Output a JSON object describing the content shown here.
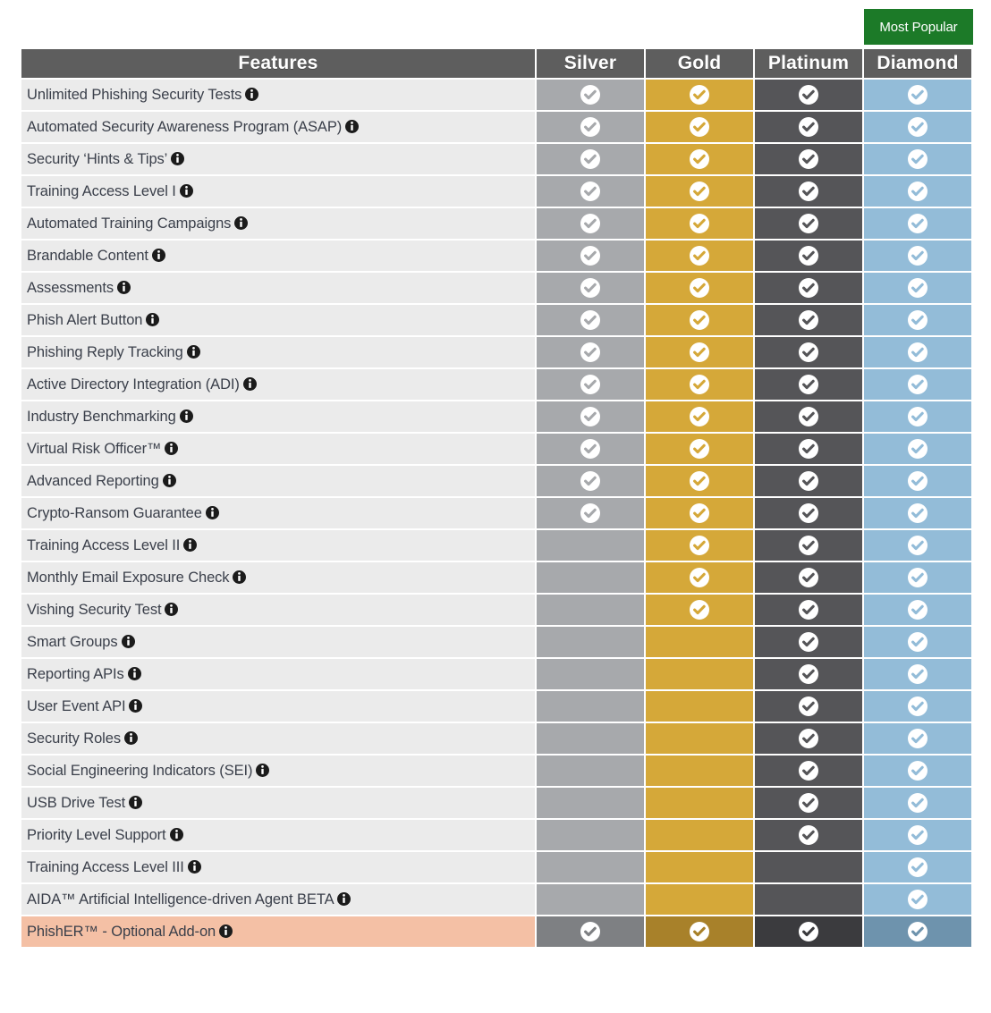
{
  "badge": {
    "label": "Most Popular",
    "color": "#1c7a28",
    "column": "Diamond"
  },
  "table": {
    "columns": [
      {
        "key": "feature",
        "label": "Features",
        "header_bg": "#5e5e5e"
      },
      {
        "key": "silver",
        "label": "Silver",
        "cell_bg": "#a7a9ac",
        "cell_bg_alt": "#7e8083"
      },
      {
        "key": "gold",
        "label": "Gold",
        "cell_bg": "#d5a839",
        "cell_bg_alt": "#a8812a"
      },
      {
        "key": "platinum",
        "label": "Platinum",
        "cell_bg": "#555558",
        "cell_bg_alt": "#3b3b3e"
      },
      {
        "key": "diamond",
        "label": "Diamond",
        "cell_bg": "#93bcd8",
        "cell_bg_alt": "#6e93ad"
      }
    ],
    "row_bg": "#ebebeb",
    "highlight_row_bg": "#f4c0a5",
    "info_icon": "info-icon",
    "check_icon": "check-circle-icon",
    "rows": [
      {
        "feature": "Unlimited Phishing Security Tests",
        "silver": true,
        "gold": true,
        "platinum": true,
        "diamond": true,
        "highlight": false
      },
      {
        "feature": "Automated Security Awareness Program (ASAP)",
        "silver": true,
        "gold": true,
        "platinum": true,
        "diamond": true,
        "highlight": false
      },
      {
        "feature": "Security ‘Hints & Tips’",
        "silver": true,
        "gold": true,
        "platinum": true,
        "diamond": true,
        "highlight": false
      },
      {
        "feature": "Training Access Level I",
        "silver": true,
        "gold": true,
        "platinum": true,
        "diamond": true,
        "highlight": false
      },
      {
        "feature": "Automated Training Campaigns",
        "silver": true,
        "gold": true,
        "platinum": true,
        "diamond": true,
        "highlight": false
      },
      {
        "feature": "Brandable Content",
        "silver": true,
        "gold": true,
        "platinum": true,
        "diamond": true,
        "highlight": false
      },
      {
        "feature": "Assessments",
        "silver": true,
        "gold": true,
        "platinum": true,
        "diamond": true,
        "highlight": false
      },
      {
        "feature": "Phish Alert Button",
        "silver": true,
        "gold": true,
        "platinum": true,
        "diamond": true,
        "highlight": false
      },
      {
        "feature": "Phishing Reply Tracking",
        "silver": true,
        "gold": true,
        "platinum": true,
        "diamond": true,
        "highlight": false
      },
      {
        "feature": "Active Directory Integration (ADI)",
        "silver": true,
        "gold": true,
        "platinum": true,
        "diamond": true,
        "highlight": false
      },
      {
        "feature": "Industry Benchmarking",
        "silver": true,
        "gold": true,
        "platinum": true,
        "diamond": true,
        "highlight": false
      },
      {
        "feature": "Virtual Risk Officer™",
        "silver": true,
        "gold": true,
        "platinum": true,
        "diamond": true,
        "highlight": false
      },
      {
        "feature": "Advanced Reporting",
        "silver": true,
        "gold": true,
        "platinum": true,
        "diamond": true,
        "highlight": false
      },
      {
        "feature": "Crypto-Ransom Guarantee",
        "silver": true,
        "gold": true,
        "platinum": true,
        "diamond": true,
        "highlight": false
      },
      {
        "feature": "Training Access Level II",
        "silver": false,
        "gold": true,
        "platinum": true,
        "diamond": true,
        "highlight": false
      },
      {
        "feature": "Monthly Email Exposure Check",
        "silver": false,
        "gold": true,
        "platinum": true,
        "diamond": true,
        "highlight": false
      },
      {
        "feature": "Vishing Security Test",
        "silver": false,
        "gold": true,
        "platinum": true,
        "diamond": true,
        "highlight": false
      },
      {
        "feature": "Smart Groups",
        "silver": false,
        "gold": false,
        "platinum": true,
        "diamond": true,
        "highlight": false
      },
      {
        "feature": "Reporting APIs",
        "silver": false,
        "gold": false,
        "platinum": true,
        "diamond": true,
        "highlight": false
      },
      {
        "feature": "User Event API",
        "silver": false,
        "gold": false,
        "platinum": true,
        "diamond": true,
        "highlight": false
      },
      {
        "feature": "Security Roles",
        "silver": false,
        "gold": false,
        "platinum": true,
        "diamond": true,
        "highlight": false
      },
      {
        "feature": "Social Engineering Indicators (SEI)",
        "silver": false,
        "gold": false,
        "platinum": true,
        "diamond": true,
        "highlight": false
      },
      {
        "feature": "USB Drive Test",
        "silver": false,
        "gold": false,
        "platinum": true,
        "diamond": true,
        "highlight": false
      },
      {
        "feature": "Priority Level Support",
        "silver": false,
        "gold": false,
        "platinum": true,
        "diamond": true,
        "highlight": false
      },
      {
        "feature": "Training Access Level III",
        "silver": false,
        "gold": false,
        "platinum": false,
        "diamond": true,
        "highlight": false
      },
      {
        "feature": "AIDA™ Artificial Intelligence-driven Agent BETA",
        "silver": false,
        "gold": false,
        "platinum": false,
        "diamond": true,
        "highlight": false
      },
      {
        "feature": "PhishER™ - Optional Add-on",
        "silver": true,
        "gold": true,
        "platinum": true,
        "diamond": true,
        "highlight": true
      }
    ]
  }
}
